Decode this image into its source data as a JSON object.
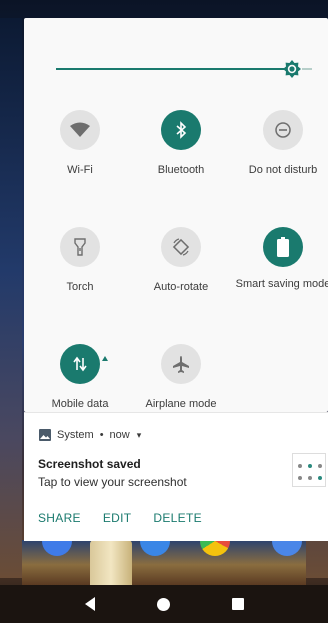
{
  "quick_settings": {
    "brightness_level": 0.9,
    "tiles": [
      {
        "label": "Wi-Fi",
        "icon": "wifi-icon",
        "state": "off"
      },
      {
        "label": "Bluetooth",
        "icon": "bluetooth-icon",
        "state": "on"
      },
      {
        "label": "Do not disturb",
        "icon": "do-not-disturb-icon",
        "state": "off"
      },
      {
        "label": "Torch",
        "icon": "torch-icon",
        "state": "off"
      },
      {
        "label": "Auto-rotate",
        "icon": "auto-rotate-icon",
        "state": "off"
      },
      {
        "label": "Smart saving mode",
        "icon": "battery-icon",
        "state": "on"
      },
      {
        "label": "Mobile data",
        "icon": "mobile-data-icon",
        "state": "on"
      },
      {
        "label": "Airplane mode",
        "icon": "airplane-icon",
        "state": "off"
      }
    ]
  },
  "notification": {
    "app_name": "System",
    "separator": "•",
    "time": "now",
    "title": "Screenshot saved",
    "subtitle": "Tap to view your screenshot",
    "actions": [
      "SHARE",
      "EDIT",
      "DELETE"
    ]
  },
  "colors": {
    "accent": "#1a7a6e",
    "tile_off": "#e2e2e2",
    "panel_bg": "#f9f9f9"
  }
}
